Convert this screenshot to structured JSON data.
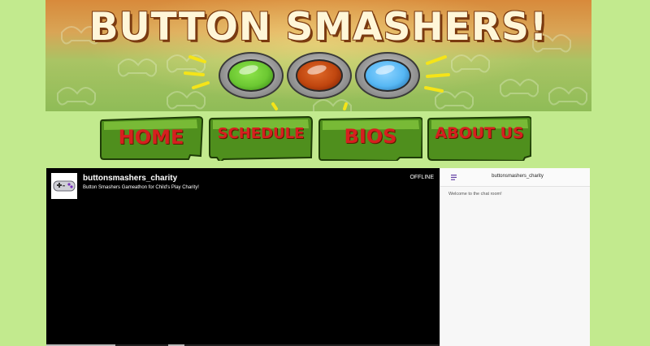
{
  "banner": {
    "title": "BUTTON SMASHERS!",
    "buttons": [
      {
        "name": "green-arcade-button",
        "color": "#6cc832",
        "dark": "#2f7d12"
      },
      {
        "name": "red-arcade-button",
        "color": "#c0460f",
        "dark": "#6e1a03"
      },
      {
        "name": "blue-arcade-button",
        "color": "#56b7f4",
        "dark": "#1c5d98"
      }
    ],
    "colors": {
      "title": "#fff6d8",
      "outline": "#7a3a10",
      "spark": "#f5e418"
    }
  },
  "nav": {
    "items": [
      {
        "label": "HOME"
      },
      {
        "label": "SCHEDULE"
      },
      {
        "label": "BIOS"
      },
      {
        "label": "ABOUT US"
      }
    ],
    "colors": {
      "tab_fill": "#4f8f1d",
      "tab_light": "#7fc23b",
      "label": "#d61f1f"
    }
  },
  "player": {
    "channel": "buttonsmashers_charity",
    "description": "Button Smashers Gameathon for Child's Play Charity!",
    "status": "OFFLINE",
    "avatar_icon": "controller-icon"
  },
  "chat": {
    "menu_icon": "menu-icon",
    "title": "buttonsmashers_charity",
    "welcome": "Welcome to the chat room!"
  },
  "colors": {
    "page_bg": "#c2ea8e",
    "player_bg": "#000000",
    "chat_bg": "#f7f7f7",
    "chat_accent": "#6441a5"
  }
}
